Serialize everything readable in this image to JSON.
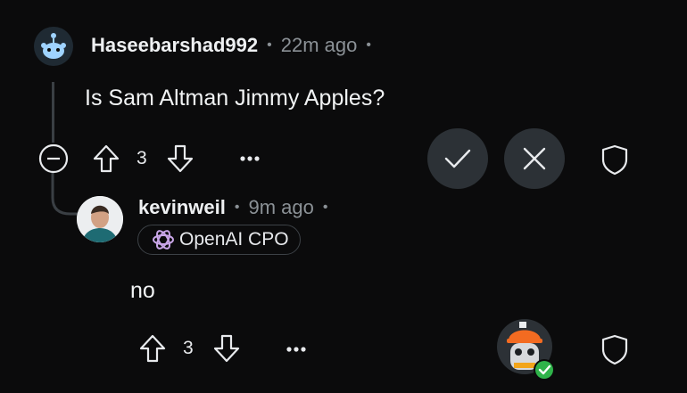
{
  "comment": {
    "username": "Haseebarshad992",
    "time": "22m ago",
    "body": "Is Sam Altman Jimmy Apples?",
    "upvotes": "3",
    "avatar_icon": "snoo-avatar-icon"
  },
  "reply": {
    "username": "kevinweil",
    "time": "9m ago",
    "flair": "OpenAI CPO",
    "body": "no",
    "upvotes": "3",
    "avatar_icon": "profile-photo"
  },
  "colors": {
    "background": "#0b0b0c",
    "muted": "#8b9196",
    "button_bg": "#2c3136",
    "verified_green": "#2fb34a"
  }
}
